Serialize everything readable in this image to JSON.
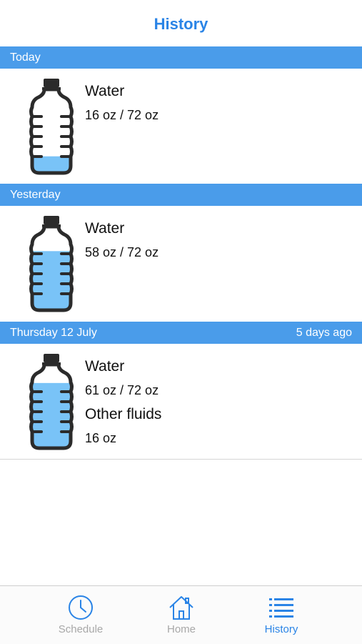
{
  "navbar": {
    "title": "History"
  },
  "sections": [
    {
      "header": "Today",
      "header_right": "",
      "entries": [
        {
          "label": "Water",
          "amount": "16 oz / 72 oz"
        }
      ],
      "fill_fraction": 0.22
    },
    {
      "header": "Yesterday",
      "header_right": "",
      "entries": [
        {
          "label": "Water",
          "amount": "58 oz / 72 oz"
        }
      ],
      "fill_fraction": 0.78
    },
    {
      "header": "Thursday 12 July",
      "header_right": "5 days ago",
      "entries": [
        {
          "label": "Water",
          "amount": "61 oz / 72 oz"
        },
        {
          "label": "Other fluids",
          "amount": "16 oz"
        }
      ],
      "fill_fraction": 0.86
    }
  ],
  "tabbar": {
    "items": [
      {
        "label": "Schedule",
        "icon": "clock-icon",
        "active": false
      },
      {
        "label": "Home",
        "icon": "home-icon",
        "active": false
      },
      {
        "label": "History",
        "icon": "list-icon",
        "active": true
      }
    ]
  },
  "colors": {
    "accent": "#2a84e6",
    "section_header": "#4a9cea",
    "water_fill": "#79c3f7",
    "bottle_outline": "#2b2b2b",
    "inactive_tab": "#a8a8a8"
  }
}
